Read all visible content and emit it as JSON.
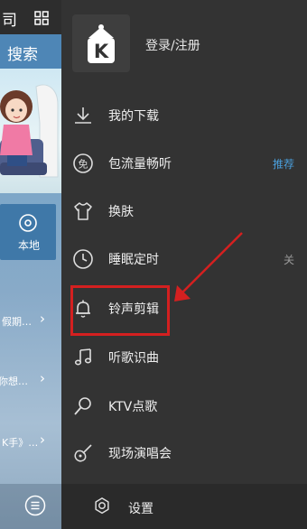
{
  "left_panel": {
    "title_fragment": "司",
    "search_tab": "搜索",
    "local_label": "本地",
    "list_items": [
      {
        "text": "假期…"
      },
      {
        "text": "你想…"
      },
      {
        "text": "K手》…"
      }
    ]
  },
  "drawer": {
    "login_label": "登录/注册",
    "menu": [
      {
        "label": "我的下载",
        "icon": "download-icon",
        "extra": ""
      },
      {
        "label": "包流量畅听",
        "icon": "free-data-icon",
        "extra": "推荐"
      },
      {
        "label": "换肤",
        "icon": "tshirt-icon",
        "extra": ""
      },
      {
        "label": "睡眠定时",
        "icon": "clock-icon",
        "extra": "关"
      },
      {
        "label": "铃声剪辑",
        "icon": "bell-icon",
        "extra": ""
      },
      {
        "label": "听歌识曲",
        "icon": "music-note-icon",
        "extra": ""
      },
      {
        "label": "KTV点歌",
        "icon": "microphone-icon",
        "extra": ""
      },
      {
        "label": "现场演唱会",
        "icon": "guitar-icon",
        "extra": ""
      }
    ],
    "settings_label": "设置"
  },
  "colors": {
    "drawer_bg": "#333333",
    "accent_blue": "#4a9fdc",
    "highlight_red": "#d42020"
  }
}
